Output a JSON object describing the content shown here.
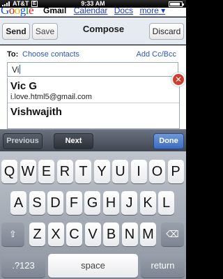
{
  "status": {
    "carrier": "AT&T",
    "network": "E",
    "time": "9:33 AM",
    "battery_level": 0.9
  },
  "google": {
    "logo": [
      "G",
      "o",
      "o",
      "g",
      "l",
      "e"
    ],
    "active_tab": "Gmail",
    "links": [
      "Calendar",
      "Docs",
      "more ▾"
    ]
  },
  "compose": {
    "send": "Send",
    "save": "Save",
    "title": "Compose",
    "discard": "Discard"
  },
  "form": {
    "to_label": "To:",
    "choose_contacts": "Choose contacts",
    "add_cc_bcc": "Add Cc/Bcc",
    "to_value": "Vi",
    "clear_icon": "✕"
  },
  "suggestions": [
    {
      "name": "Vic G",
      "email": "i.love.html5@gmail.com"
    },
    {
      "name": "Vishwajith",
      "email": ""
    }
  ],
  "assist": {
    "previous": "Previous",
    "next": "Next",
    "done": "Done"
  },
  "keyboard": {
    "row1": [
      "Q",
      "W",
      "E",
      "R",
      "T",
      "Y",
      "U",
      "I",
      "O",
      "P"
    ],
    "row2": [
      "A",
      "S",
      "D",
      "F",
      "G",
      "H",
      "J",
      "K",
      "L"
    ],
    "row3": [
      "Z",
      "X",
      "C",
      "V",
      "B",
      "N",
      "M"
    ],
    "shift": "⇧",
    "backspace": "⌫",
    "numbers": ".?123",
    "space": "space",
    "return": "return"
  }
}
